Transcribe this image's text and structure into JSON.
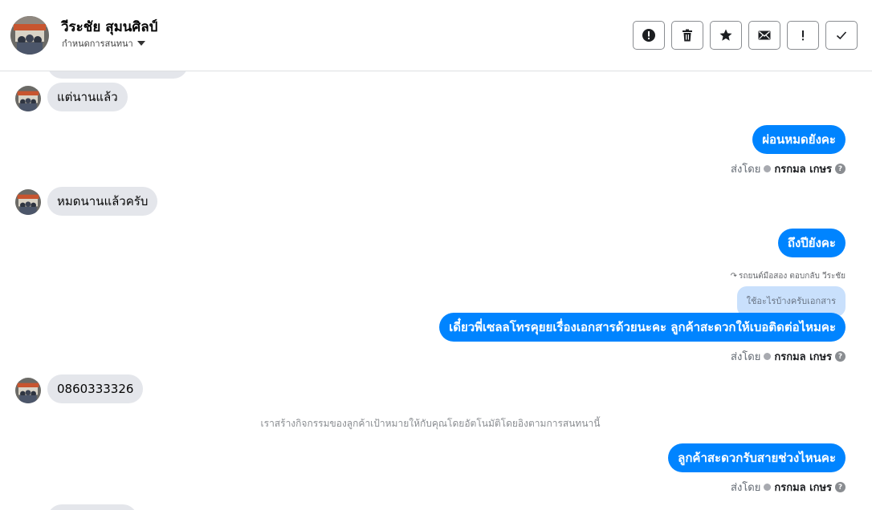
{
  "header": {
    "contact_name": "วีระชัย สุมนศิลป์",
    "conversation_settings": "กำหนดการสนทนา",
    "actions": [
      {
        "icon": "alert-circle-icon",
        "name": "mark-spam-button"
      },
      {
        "icon": "trash-icon",
        "name": "delete-button"
      },
      {
        "icon": "star-icon",
        "name": "star-button"
      },
      {
        "icon": "envelope-icon",
        "name": "mark-unread-button"
      },
      {
        "icon": "exclamation-icon",
        "name": "follow-up-button"
      },
      {
        "icon": "checkmark-icon",
        "name": "mark-done-button"
      }
    ]
  },
  "messages": {
    "m1": "แต่นานแล้ว",
    "m2": "ผ่อนหมดยังคะ",
    "m3": "หมดนานแล้วครับ",
    "m4": "ถึงปียังคะ",
    "m5": "เดี๋ยวพี่เซลลโทรคุยยเรื่องเอกสารด้วยนะคะ  ลูกค้าสะดวกให้เบอติดต่อไหมคะ",
    "m6": "0860333326",
    "m7": "ลูกค้าสะดวกรับสายช่วงไหนคะ"
  },
  "sent_meta": {
    "prefix": "ส่งโดย",
    "sender": "กรกมล เกษร",
    "help": "?"
  },
  "reply": {
    "note": "รถยนต์มือสอง ตอบกลับ วีระชัย",
    "quoted": "ใช้อะไรบ้างครับเอกสาร"
  },
  "system_note": "เราสร้างกิจกรรมของลูกค้าเป้าหมายให้กับคุณโดยอัตโนมัติโดยอิงตามการสนทนานี้",
  "colors": {
    "outgoing_bubble": "#0084ff",
    "incoming_bubble": "#e4e6eb",
    "quoted_bubble": "#c9e0fc"
  }
}
